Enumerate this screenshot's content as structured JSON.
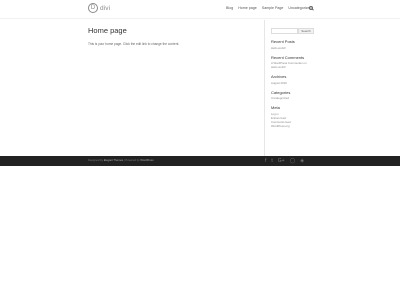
{
  "logo": {
    "mark": "D",
    "text": "divi"
  },
  "nav": {
    "items": [
      "Blog",
      "Home page",
      "Sample Page",
      "Uncategorized"
    ]
  },
  "main": {
    "title": "Home page",
    "body": "This is your home page. Click the edit link to change the content."
  },
  "sidebar": {
    "search_button": "Search",
    "recent_posts": {
      "title": "Recent Posts",
      "items": [
        "Hello world!"
      ]
    },
    "recent_comments": {
      "title": "Recent Comments",
      "items": [
        "A WordPress Commenter on",
        "Hello world!"
      ]
    },
    "archives": {
      "title": "Archives",
      "items": [
        "August 2019"
      ]
    },
    "categories": {
      "title": "Categories",
      "items": [
        "Uncategorized"
      ]
    },
    "meta": {
      "title": "Meta",
      "items": [
        "Log in",
        "Entries feed",
        "Comments feed",
        "WordPress.org"
      ]
    }
  },
  "footer": {
    "designed_by_prefix": "Designed by",
    "designed_by_link": "Elegant Themes",
    "powered_by_prefix": "| Powered by",
    "powered_by_link": "WordPress",
    "social_icons": [
      "facebook-icon",
      "twitter-icon",
      "google-plus-icon",
      "instagram-icon",
      "rss-icon"
    ]
  }
}
